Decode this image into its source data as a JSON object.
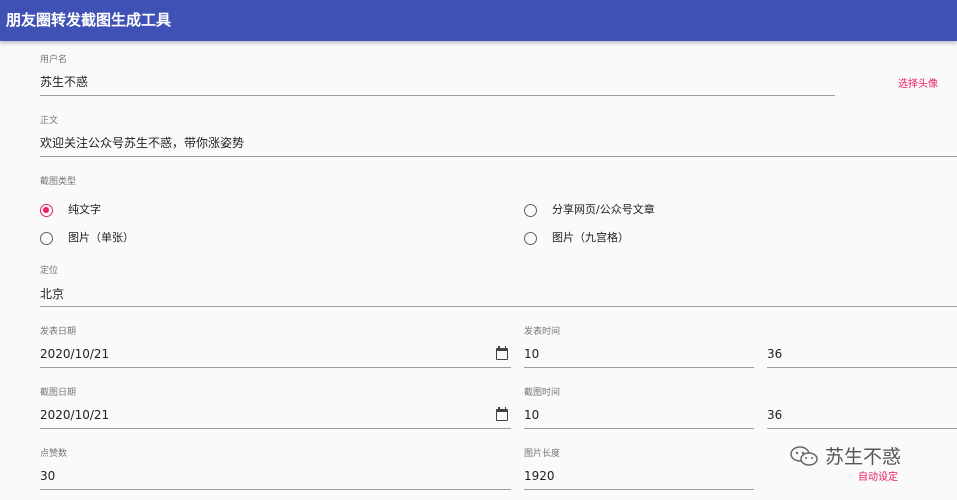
{
  "app": {
    "title": "朋友圈转发截图生成工具"
  },
  "username": {
    "label": "用户名",
    "value": "苏生不惑",
    "avatar_link": "选择头像"
  },
  "body": {
    "label": "正文",
    "value": "欢迎关注公众号苏生不惑，带你涨姿势"
  },
  "type": {
    "label": "截图类型",
    "options": [
      {
        "label": "纯文字",
        "checked": true
      },
      {
        "label": "分享网页/公众号文章",
        "checked": false
      },
      {
        "label": "图片（单张）",
        "checked": false
      },
      {
        "label": "图片（九宫格）",
        "checked": false
      }
    ]
  },
  "location": {
    "label": "定位",
    "value": "北京"
  },
  "publish": {
    "date_label": "发表日期",
    "date": "2020/10/21",
    "time_label": "发表时间",
    "hour": "10",
    "minute": "36"
  },
  "capture": {
    "date_label": "截图日期",
    "date": "2020/10/21",
    "time_label": "截图时间",
    "hour": "10",
    "minute": "36"
  },
  "likes": {
    "label": "点赞数",
    "value": "30"
  },
  "image_length": {
    "label": "图片长度",
    "value": "1920"
  },
  "auto_set": "自动设定",
  "watermark": "苏生不惑",
  "colors": {
    "appbar": "#3f51b5",
    "accent": "#e91e63"
  }
}
